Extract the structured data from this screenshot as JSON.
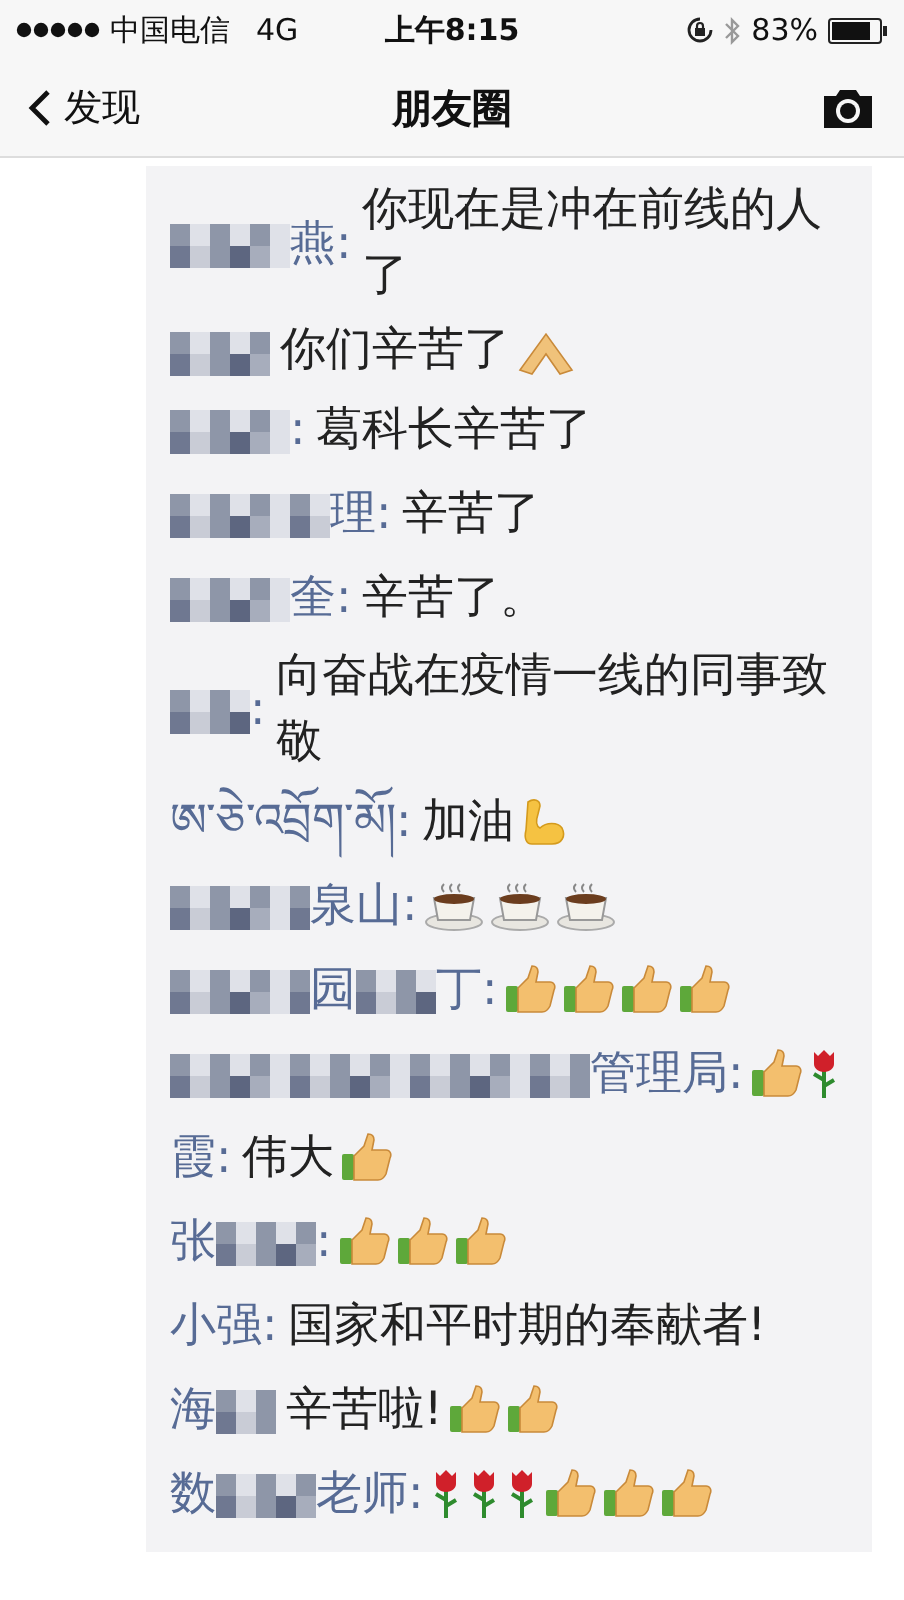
{
  "status_bar": {
    "carrier": "中国电信",
    "network": "4G",
    "time": "上午8:15",
    "battery": "83%"
  },
  "nav": {
    "back": "发现",
    "title": "朋友圈"
  },
  "comments": [
    {
      "name": [
        {
          "kind": "mosaic-large"
        },
        {
          "kind": "text",
          "text": "燕:"
        }
      ],
      "text": "你现在是冲在前线的人了"
    },
    {
      "name": [
        {
          "kind": "mosaic-medium"
        }
      ],
      "text": "你们辛苦了",
      "emojis": [
        {
          "kind": "pray"
        }
      ]
    },
    {
      "name": [
        {
          "kind": "mosaic-large"
        },
        {
          "kind": "text",
          "text": ":"
        }
      ],
      "text": "葛科长辛苦了"
    },
    {
      "name": [
        {
          "kind": "mosaic-wide"
        },
        {
          "kind": "text",
          "text": "理:"
        }
      ],
      "text": "辛苦了"
    },
    {
      "name": [
        {
          "kind": "mosaic-large"
        },
        {
          "kind": "text",
          "text": "奎:"
        }
      ],
      "text": "辛苦了。"
    },
    {
      "name": [
        {
          "kind": "mosaic-small"
        },
        {
          "kind": "text",
          "text": ":"
        }
      ],
      "text": "向奋战在疫情一线的同事致敬"
    },
    {
      "name": [
        {
          "kind": "text",
          "text": "ཨ་ཅེ་འབྲོག་མོ།:"
        }
      ],
      "text": "加油",
      "emojis": [
        {
          "kind": "muscle"
        }
      ]
    },
    {
      "name": [
        {
          "kind": "mosaic-larger"
        },
        {
          "kind": "text",
          "text": "泉山:"
        }
      ],
      "emojis": [
        {
          "kind": "coffee"
        },
        {
          "kind": "coffee"
        },
        {
          "kind": "coffee"
        }
      ]
    },
    {
      "name": [
        {
          "kind": "mosaic-larger"
        },
        {
          "kind": "text",
          "text": "园"
        },
        {
          "kind": "mosaic-small"
        },
        {
          "kind": "text",
          "text": "丁:"
        }
      ],
      "emojis": [
        {
          "kind": "thumbs"
        },
        {
          "kind": "thumbs"
        },
        {
          "kind": "thumbs"
        },
        {
          "kind": "thumbs"
        }
      ]
    },
    {
      "name": [
        {
          "kind": "mosaic-widest"
        },
        {
          "kind": "text",
          "text": "管理局:"
        }
      ],
      "emojis": [
        {
          "kind": "thumbs"
        },
        {
          "kind": "rose"
        }
      ]
    },
    {
      "name": [
        {
          "kind": "text",
          "text": "霞:"
        }
      ],
      "text": "伟大",
      "emojis": [
        {
          "kind": "thumbs"
        }
      ]
    },
    {
      "name": [
        {
          "kind": "text",
          "text": "张"
        },
        {
          "kind": "mosaic-medium"
        },
        {
          "kind": "text",
          "text": ":"
        }
      ],
      "emojis": [
        {
          "kind": "thumbs"
        },
        {
          "kind": "thumbs"
        },
        {
          "kind": "thumbs"
        }
      ]
    },
    {
      "name": [
        {
          "kind": "text",
          "text": "小强:"
        }
      ],
      "text": "国家和平时期的奉献者!"
    },
    {
      "name": [
        {
          "kind": "text",
          "text": "海"
        },
        {
          "kind": "mosaic-tiny"
        }
      ],
      "text": "辛苦啦!",
      "emojis": [
        {
          "kind": "thumbs"
        },
        {
          "kind": "thumbs"
        }
      ]
    },
    {
      "name": [
        {
          "kind": "text",
          "text": "数"
        },
        {
          "kind": "mosaic-medium"
        },
        {
          "kind": "text",
          "text": "老师:"
        }
      ],
      "emojis": [
        {
          "kind": "rose"
        },
        {
          "kind": "rose"
        },
        {
          "kind": "rose"
        },
        {
          "kind": "thumbs"
        },
        {
          "kind": "thumbs"
        },
        {
          "kind": "thumbs"
        }
      ]
    }
  ]
}
